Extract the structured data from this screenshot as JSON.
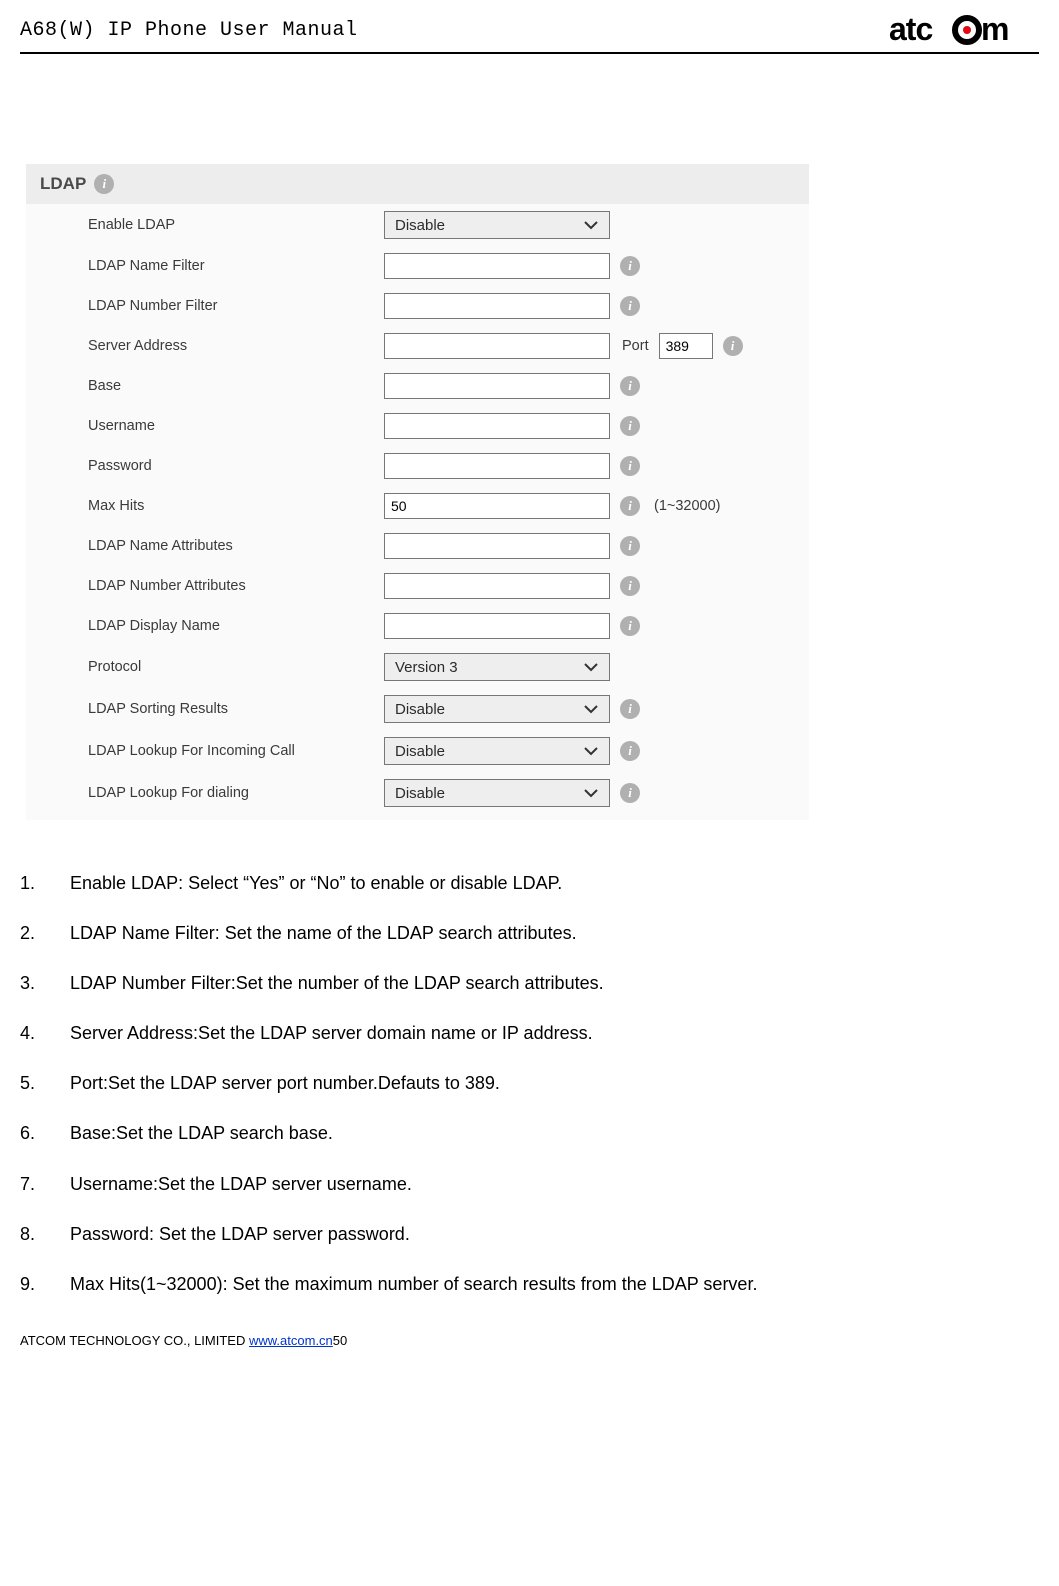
{
  "header": {
    "title": "A68(W) IP Phone User Manual",
    "logo_text": "atcom",
    "logo_accent": "#e30613"
  },
  "form": {
    "title": "LDAP",
    "port_label": "Port",
    "rows": [
      {
        "label": "Enable LDAP",
        "type": "select",
        "value": "Disable",
        "info": false,
        "extra": null
      },
      {
        "label": "LDAP Name Filter",
        "type": "text",
        "value": "",
        "info": true,
        "extra": null
      },
      {
        "label": "LDAP Number Filter",
        "type": "text",
        "value": "",
        "info": true,
        "extra": null
      },
      {
        "label": "Server Address",
        "type": "text",
        "value": "",
        "info": true,
        "extra": "port",
        "port_value": "389"
      },
      {
        "label": "Base",
        "type": "text",
        "value": "",
        "info": true,
        "extra": null
      },
      {
        "label": "Username",
        "type": "text",
        "value": "",
        "info": true,
        "extra": null
      },
      {
        "label": "Password",
        "type": "text",
        "value": "",
        "info": true,
        "extra": null
      },
      {
        "label": "Max Hits",
        "type": "text",
        "value": "50",
        "info": true,
        "extra": "hint",
        "hint": "(1~32000)"
      },
      {
        "label": "LDAP Name Attributes",
        "type": "text",
        "value": "",
        "info": true,
        "extra": null
      },
      {
        "label": "LDAP Number Attributes",
        "type": "text",
        "value": "",
        "info": true,
        "extra": null
      },
      {
        "label": "LDAP Display Name",
        "type": "text",
        "value": "",
        "info": true,
        "extra": null
      },
      {
        "label": "Protocol",
        "type": "select",
        "value": "Version 3",
        "info": false,
        "extra": null
      },
      {
        "label": "LDAP Sorting Results",
        "type": "select",
        "value": "Disable",
        "info": true,
        "extra": null
      },
      {
        "label": "LDAP Lookup For Incoming Call",
        "type": "select",
        "value": "Disable",
        "info": true,
        "extra": null
      },
      {
        "label": "LDAP Lookup For dialing",
        "type": "select",
        "value": "Disable",
        "info": true,
        "extra": null
      }
    ]
  },
  "instructions": [
    "Enable LDAP: Select \"Yes\" or \"No\" to enable or disable LDAP.",
    "LDAP Name Filter: Set the name of the LDAP search attributes.",
    "LDAP Number Filter:Set the number of the LDAP search attributes.",
    "Server Address:Set the LDAP server domain name or IP address.",
    "Port:Set the LDAP server port number.Defauts to 389.",
    "Base:Set the LDAP search base.",
    "Username:Set the LDAP server username.",
    "Password: Set the LDAP server password.",
    "Max Hits(1~32000): Set the maximum number of search results from the LDAP server."
  ],
  "footer": {
    "company": "ATCOM TECHNOLOGY CO., LIMITED ",
    "link": "www.atcom.cn",
    "page": "50"
  }
}
